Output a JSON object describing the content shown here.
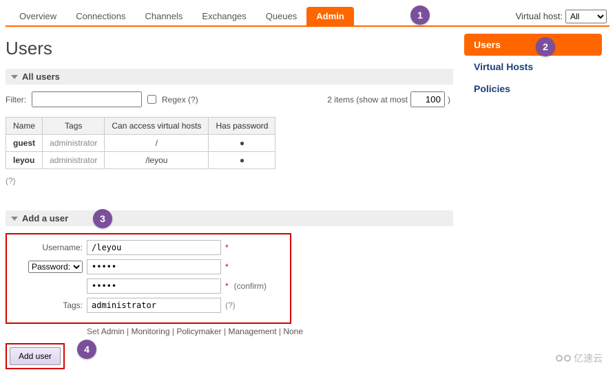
{
  "nav": {
    "tabs": [
      "Overview",
      "Connections",
      "Channels",
      "Exchanges",
      "Queues",
      "Admin"
    ],
    "active": "Admin",
    "vhost_label": "Virtual host:",
    "vhost_value": "All"
  },
  "sidebar": {
    "items": [
      "Users",
      "Virtual Hosts",
      "Policies"
    ],
    "active": "Users"
  },
  "page": {
    "title": "Users"
  },
  "sections": {
    "all_users": "All users",
    "add_user": "Add a user"
  },
  "filter": {
    "label": "Filter:",
    "value": "",
    "regex_label": "Regex (?)",
    "regex_checked": false,
    "items_text_prefix": "2 items (show at most",
    "items_max": "100",
    "items_text_suffix": ")"
  },
  "users_table": {
    "headers": [
      "Name",
      "Tags",
      "Can access virtual hosts",
      "Has password"
    ],
    "rows": [
      {
        "name": "guest",
        "tags": "administrator",
        "vhosts": "/",
        "has_password": "●"
      },
      {
        "name": "leyou",
        "tags": "administrator",
        "vhosts": "/leyou",
        "has_password": "●"
      }
    ]
  },
  "help": "(?)",
  "form": {
    "username_label": "Username:",
    "username_value": "/leyou",
    "password_label": "Password:",
    "password_value": "•••••",
    "password_confirm_value": "•••••",
    "confirm_text": "(confirm)",
    "tags_label": "Tags:",
    "tags_value": "administrator",
    "required": "*",
    "q": "(?)",
    "shortcuts_prefix": "Set ",
    "shortcuts": [
      "Admin",
      "Monitoring",
      "Policymaker",
      "Management",
      "None"
    ],
    "submit": "Add user"
  },
  "callouts": {
    "c1": "1",
    "c2": "2",
    "c3": "3",
    "c4": "4"
  },
  "watermark": "亿速云"
}
